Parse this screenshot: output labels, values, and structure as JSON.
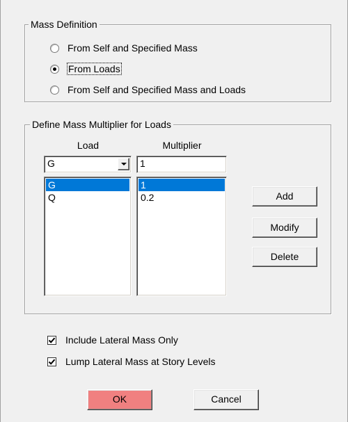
{
  "mass_definition": {
    "legend": "Mass Definition",
    "options": [
      {
        "label": "From Self and Specified Mass",
        "checked": false
      },
      {
        "label": "From Loads",
        "checked": true
      },
      {
        "label": "From Self and Specified Mass and Loads",
        "checked": false
      }
    ]
  },
  "multiplier_group": {
    "legend": "Define Mass Multiplier for Loads",
    "load_header": "Load",
    "multiplier_header": "Multiplier",
    "load_select_value": "G",
    "multiplier_input_value": "1",
    "load_list": [
      "G",
      "Q"
    ],
    "multiplier_list": [
      "1",
      "0.2"
    ],
    "selected_row": 0,
    "buttons": {
      "add": "Add",
      "modify": "Modify",
      "delete": "Delete"
    }
  },
  "options": {
    "include_lateral_mass_only": {
      "label": "Include Lateral Mass Only",
      "checked": true
    },
    "lump_lateral_mass": {
      "label": "Lump Lateral Mass at Story Levels",
      "checked": true
    }
  },
  "footer": {
    "ok": "OK",
    "cancel": "Cancel"
  },
  "colors": {
    "selection": "#0078d7",
    "ok_button": "#f08080",
    "dialog_bg": "#f0f0f0"
  }
}
